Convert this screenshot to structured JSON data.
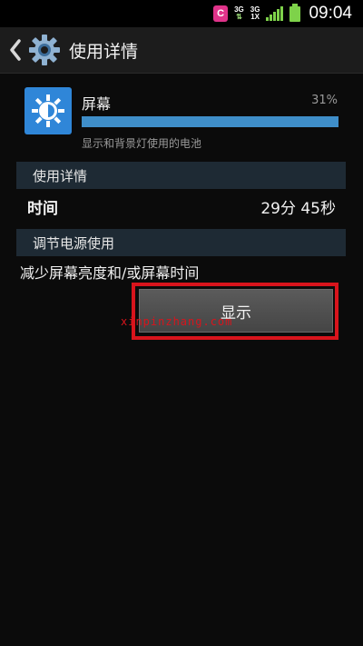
{
  "status_bar": {
    "app_badge": "C",
    "net1": "3G",
    "net2_top": "3G",
    "net2_bottom": "1X",
    "time": "09:04",
    "icons": [
      "app-notification-icon",
      "data-transfer-icon",
      "signal-icon",
      "battery-icon"
    ]
  },
  "header": {
    "title": "使用详情",
    "icons": [
      "back-icon",
      "gear-icon"
    ]
  },
  "app_entry": {
    "name": "屏幕",
    "percent_label": "31%",
    "usage_fraction": 0.31,
    "description": "显示和背景灯使用的电池",
    "icon": "brightness-icon",
    "accent_color": "#2f86d8",
    "bar_color": "#3f8ec9"
  },
  "usage_details": {
    "header": "使用详情",
    "time_label": "时间",
    "time_value": "29分 45秒"
  },
  "power_adjust": {
    "header": "调节电源使用",
    "advice": "减少屏幕亮度和/或屏幕时间",
    "button_label": "显示"
  },
  "watermark": "xinpinzhang.com",
  "highlight_color": "#d8141c"
}
